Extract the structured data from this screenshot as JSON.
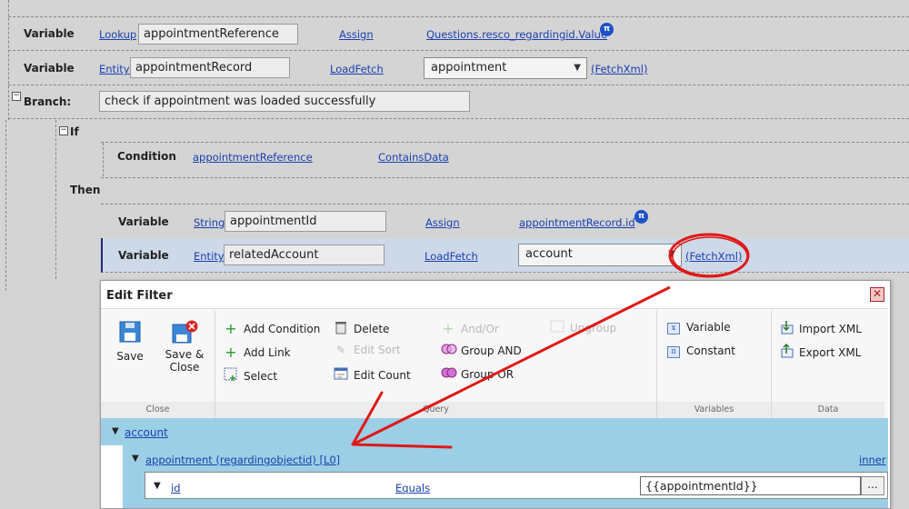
{
  "rows": {
    "r1": {
      "type_label": "Variable",
      "kind": "Lookup",
      "name": "appointmentReference",
      "op": "Assign",
      "value": "Questions.resco_regardingid.Value"
    },
    "r2": {
      "type_label": "Variable",
      "kind": "Entity",
      "name": "appointmentRecord",
      "op": "LoadFetch",
      "entity": "appointment",
      "fetch": "(FetchXml)"
    },
    "branch": {
      "label": "Branch:",
      "value": "check if appointment was loaded successfully"
    },
    "if_label": "If",
    "cond": {
      "type_label": "Condition",
      "field": "appointmentReference",
      "op": "ContainsData"
    },
    "then_label": "Then",
    "r3": {
      "type_label": "Variable",
      "kind": "String",
      "name": "appointmentId",
      "op": "Assign",
      "value": "appointmentRecord.id"
    },
    "r4": {
      "type_label": "Variable",
      "kind": "Entity",
      "name": "relatedAccount",
      "op": "LoadFetch",
      "entity": "account",
      "fetch": "(FetchXml)"
    }
  },
  "pi_symbol": "π",
  "toggle_minus": "−",
  "dialog": {
    "title": "Edit Filter",
    "close_symbol": "✕",
    "ribbon": {
      "close_group": {
        "save": "Save",
        "save_close_line1": "Save &",
        "save_close_line2": "Close",
        "footer": "Close"
      },
      "query_group": {
        "add_condition": "Add Condition",
        "add_link": "Add Link",
        "select": "Select",
        "delete": "Delete",
        "edit_sort": "Edit Sort",
        "edit_count": "Edit Count",
        "and_or": "And/Or",
        "group_and": "Group AND",
        "group_or": "Group OR",
        "ungroup": "Ungroup",
        "footer": "Query"
      },
      "variables_group": {
        "variable": "Variable",
        "constant": "Constant",
        "footer": "Variables"
      },
      "data_group": {
        "import_xml": "Import XML",
        "export_xml": "Export XML",
        "footer": "Data"
      }
    },
    "tree": {
      "root": "account",
      "link": "appointment (regardingobjectid) [L0]",
      "link_type": "inner",
      "condition": {
        "attribute": "id",
        "operator": "Equals",
        "value": "{{appointmentId}}",
        "more": "..."
      }
    }
  },
  "colors": {
    "annotation": "#e01818",
    "link": "#1a3fb0",
    "tree_bg": "#9ccfe6",
    "pi_badge": "#1e50c8"
  }
}
